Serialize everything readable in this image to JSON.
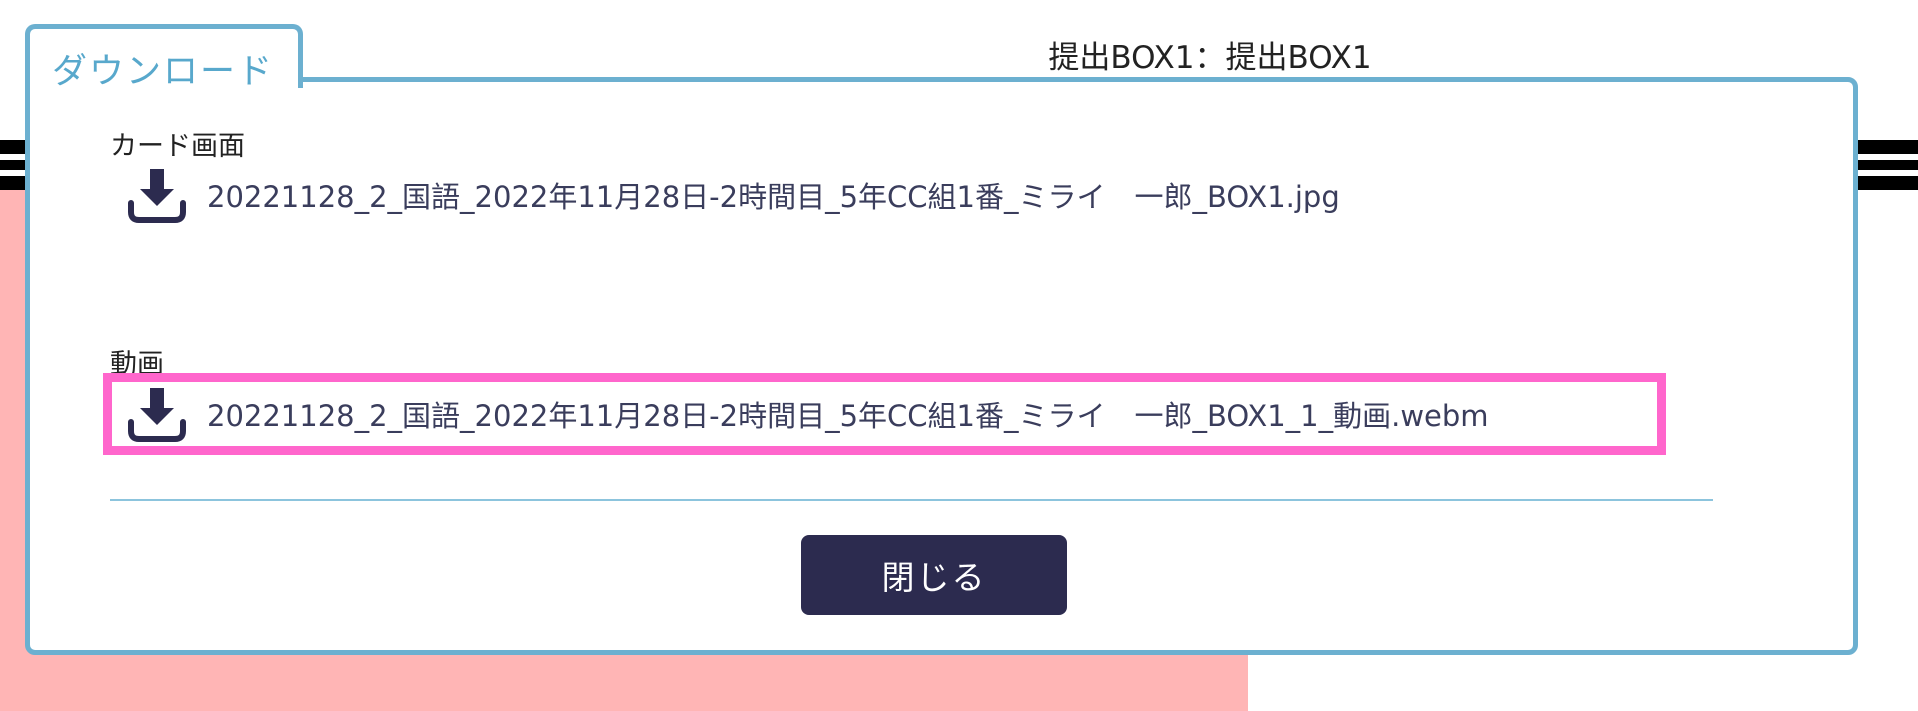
{
  "background": {
    "page_title": "提出BOX1：提出BOX1"
  },
  "dialog": {
    "title": "ダウンロード",
    "sections": [
      {
        "label": "カード画面",
        "file_name": "20221128_2_国語_2022年11月28日-2時間目_5年CC組1番_ミライ　一郎_BOX1.jpg",
        "icon": "download-icon"
      },
      {
        "label": "動画",
        "file_name": "20221128_2_国語_2022年11月28日-2時間目_5年CC組1番_ミライ　一郎_BOX1_1_動画.webm",
        "icon": "download-icon",
        "highlighted": true
      }
    ],
    "close_label": "閉じる"
  },
  "colors": {
    "accent": "#6cb0d0",
    "highlight": "#ff66cc",
    "button": "#2c2b4f",
    "file_text": "#3a3d5c",
    "background_pink": "#ffb5b5"
  }
}
